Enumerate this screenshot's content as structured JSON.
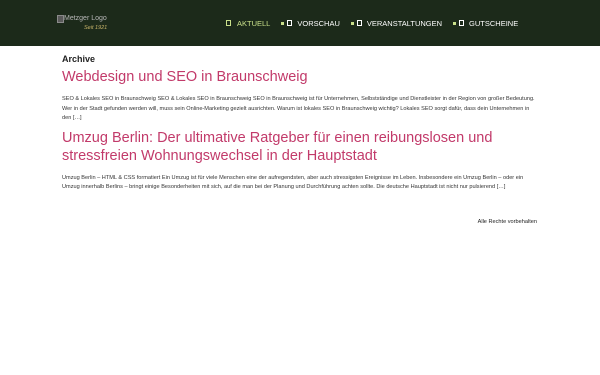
{
  "header": {
    "logo_alt": "Metzger Logo",
    "logo_sub": "Seit 1921"
  },
  "nav": {
    "items": [
      {
        "label": "AKTUELL",
        "icon": "document-icon",
        "active": true
      },
      {
        "label": "VORSCHAU",
        "icon": "news-icon",
        "active": false
      },
      {
        "label": "VERANSTALTUNGEN",
        "icon": "calendar-icon",
        "active": false
      },
      {
        "label": "GUTSCHEINE",
        "icon": "gift-icon",
        "active": false
      }
    ]
  },
  "main": {
    "archive_label": "Archive",
    "posts": [
      {
        "title": "Webdesign und SEO in Braunschweig",
        "excerpt": "SEO & Lokales SEO in Braunschweig SEO & Lokales SEO in Braunschweig SEO in Braunschweig ist für Unternehmen, Selbstständige und Dienstleister in der Region von großer Bedeutung. Wer in der Stadt gefunden werden will, muss sein Online-Marketing gezielt ausrichten. Warum ist lokales SEO in Braunschweig wichtig? Lokales SEO sorgt dafür, dass dein Unternehmen in den […]"
      },
      {
        "title": "Umzug Berlin: Der ultimative Ratgeber für einen reibungslosen und stressfreien Wohnungswechsel in der Hauptstadt",
        "excerpt": "Umzug Berlin – HTML & CSS formatiert Ein Umzug ist für viele Menschen eine der aufregendsten, aber auch stressigsten Ereignisse im Leben. Insbesondere ein Umzug Berlin – oder ein Umzug innerhalb Berlins – bringt einige Besonderheiten mit sich, auf die man bei der Planung und Durchführung achten sollte. Die deutsche Hauptstadt ist nicht nur pulsierend […]"
      }
    ]
  },
  "footer": {
    "rights": "Alle Rechte vorbehalten"
  },
  "colors": {
    "header_bg": "#1c2a1a",
    "nav_active": "#c9e08a",
    "link": "#c23a6a"
  }
}
